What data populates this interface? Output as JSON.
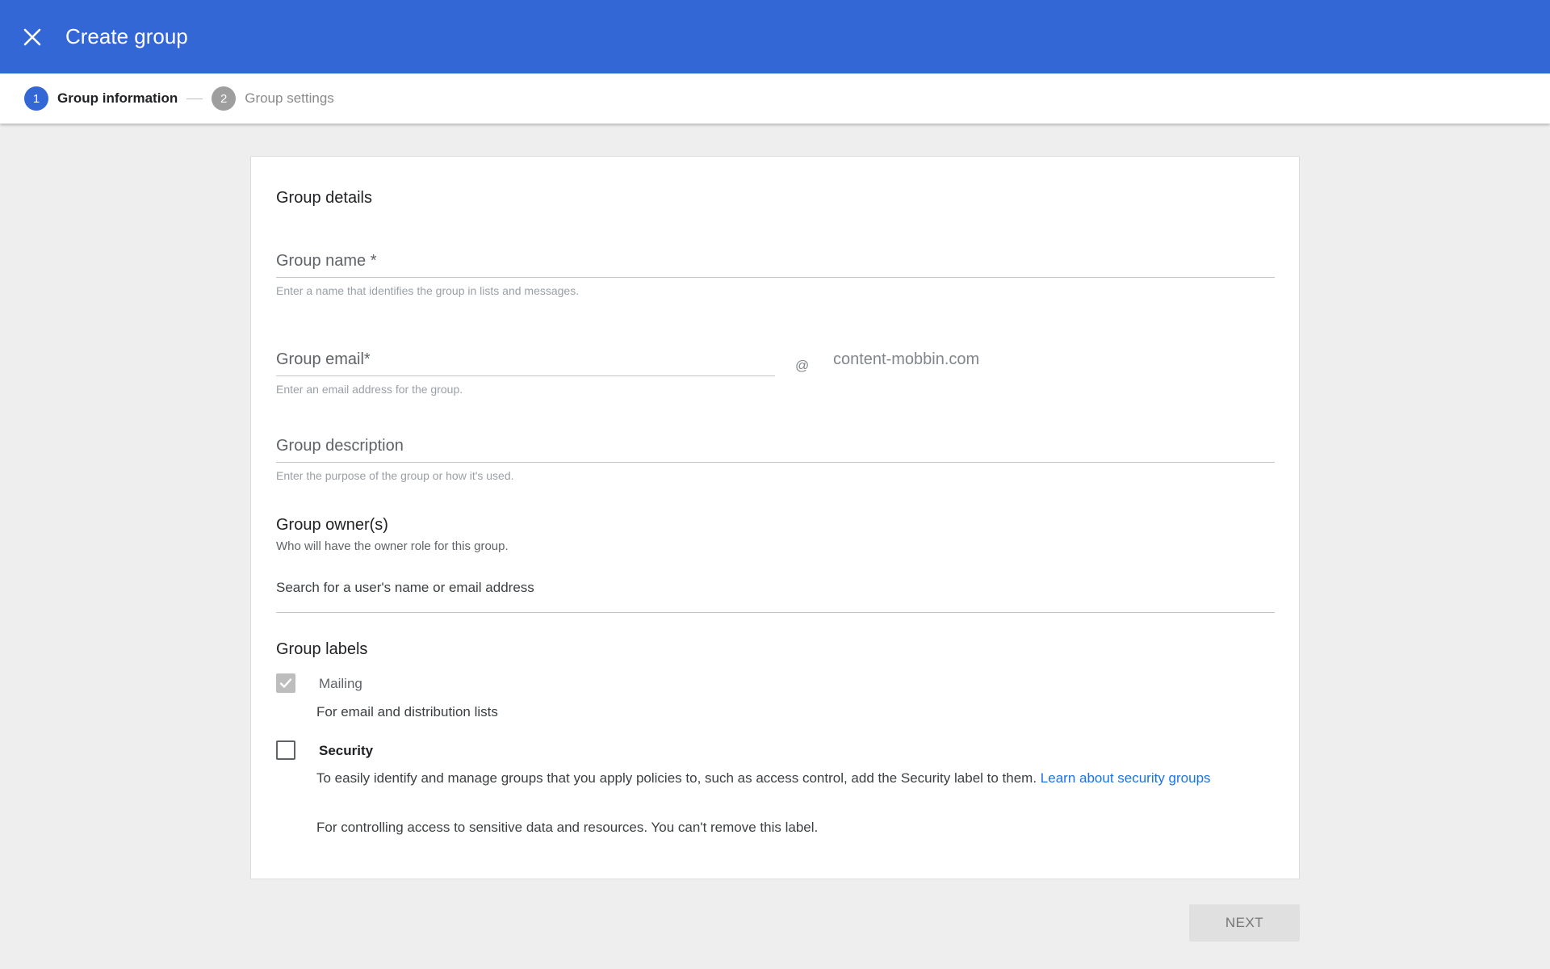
{
  "header": {
    "title": "Create group",
    "close_icon": "close-icon",
    "background_color": "#3367d6"
  },
  "stepper": {
    "steps": [
      {
        "number": "1",
        "label": "Group information",
        "active": true
      },
      {
        "number": "2",
        "label": "Group settings",
        "active": false
      }
    ]
  },
  "form": {
    "section_title": "Group details",
    "group_name": {
      "label": "Group name *",
      "hint": "Enter a name that identifies the group in lists and messages."
    },
    "group_email": {
      "label": "Group email*",
      "at": "@",
      "domain": "content-mobbin.com",
      "hint": "Enter an email address for the group."
    },
    "group_description": {
      "label": "Group description",
      "hint": "Enter the purpose of the group or how it's used."
    },
    "owners": {
      "title": "Group owner(s)",
      "subtitle": "Who will have the owner role for this group.",
      "search_placeholder": "Search for a user's name or email address"
    },
    "labels": {
      "title": "Group labels",
      "mailing": {
        "label": "Mailing",
        "description": "For email and distribution lists",
        "checked": true
      },
      "security": {
        "label": "Security",
        "description": "To easily identify and manage groups that you apply policies to, such as access control, add the Security label to them.",
        "link_text": "Learn about security groups",
        "description2": "For controlling access to sensitive data and resources. You can't remove this label.",
        "checked": false
      }
    }
  },
  "footer": {
    "next_label": "NEXT"
  }
}
